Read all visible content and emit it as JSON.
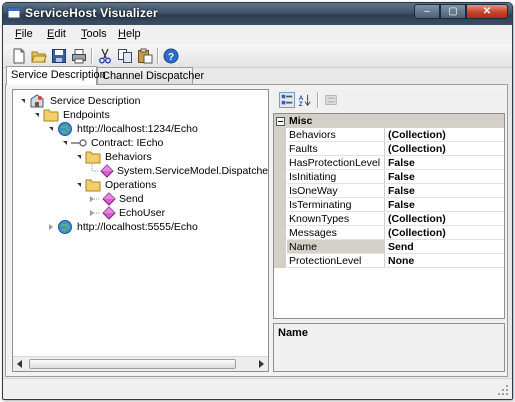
{
  "window": {
    "title": "ServiceHost Visualizer",
    "icon": "app-window-icon"
  },
  "titlebar_buttons": [
    {
      "name": "minimize-button",
      "glyph": "‒"
    },
    {
      "name": "maximize-button",
      "glyph": "▢"
    },
    {
      "name": "close-button",
      "glyph": "✕"
    }
  ],
  "menu": {
    "file": "File",
    "file_key": "F",
    "edit": "Edit",
    "edit_key": "E",
    "tools": "Tools",
    "tools_key": "T",
    "help": "Help",
    "help_key": "H"
  },
  "toolbar": {
    "icons": [
      "new-document-icon",
      "open-folder-icon",
      "save-icon",
      "print-icon",
      "cut-icon",
      "copy-icon",
      "paste-icon",
      "help-icon"
    ]
  },
  "tabs": {
    "service_description": "Service Description",
    "channel_dispatcher": "Channel Discpatcher"
  },
  "tree": {
    "root": "Service Description",
    "endpoints": "Endpoints",
    "endpoint1": "http://localhost:1234/Echo",
    "contract": "Contract: IEcho",
    "behaviors": "Behaviors",
    "behavior_item": "System.ServiceModel.Dispatcher",
    "operations": "Operations",
    "op_send": "Send",
    "op_echouser": "EchoUser",
    "endpoint2": "http://localhost:5555/Echo"
  },
  "propgrid": {
    "toolbar_icons": [
      "categorized-icon",
      "alphabetical-icon",
      "property-pages-icon"
    ],
    "category": "Misc",
    "rows": [
      {
        "name": "Behaviors",
        "value": "(Collection)"
      },
      {
        "name": "Faults",
        "value": "(Collection)"
      },
      {
        "name": "HasProtectionLevel",
        "value": "False"
      },
      {
        "name": "IsInitiating",
        "value": "False"
      },
      {
        "name": "IsOneWay",
        "value": "False"
      },
      {
        "name": "IsTerminating",
        "value": "False"
      },
      {
        "name": "KnownTypes",
        "value": "(Collection)"
      },
      {
        "name": "Messages",
        "value": "(Collection)"
      },
      {
        "name": "Name",
        "value": "Send"
      },
      {
        "name": "ProtectionLevel",
        "value": "None"
      }
    ],
    "selected_index": 8,
    "description_title": "Name"
  },
  "colors": {
    "titlebar": "#3f5468",
    "close": "#c7432b",
    "grid_margin": "#d4d0c8"
  }
}
